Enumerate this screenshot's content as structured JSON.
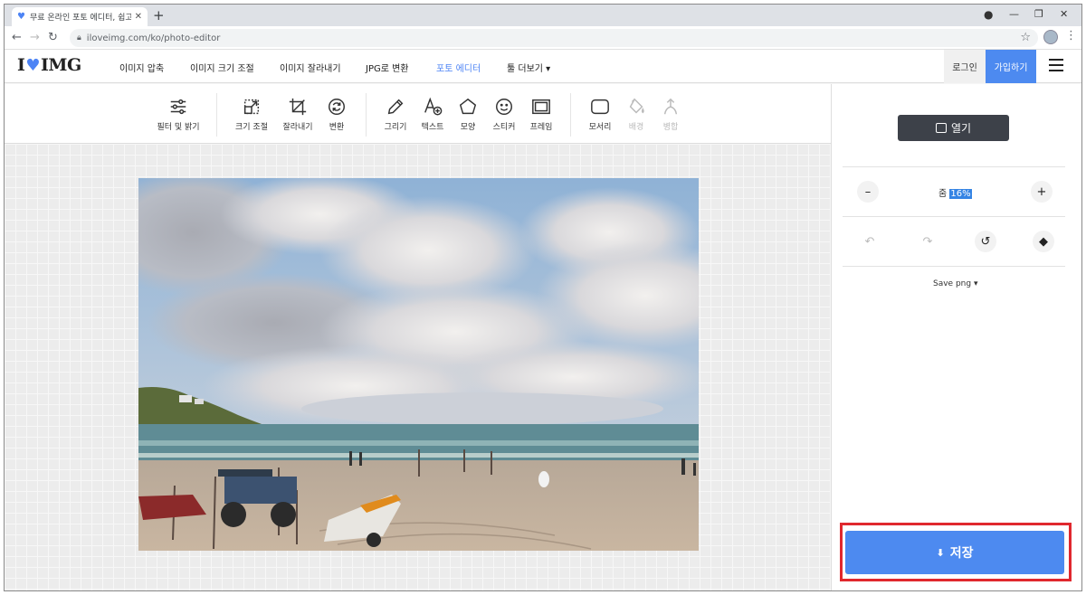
{
  "browser": {
    "tab_title": "무료 온라인 포토 에디터, 쉽고 빠",
    "url": "iloveimg.com/ko/photo-editor"
  },
  "header": {
    "logo_left": "I",
    "logo_right": "IMG",
    "nav": [
      {
        "label": "이미지 압축"
      },
      {
        "label": "이미지 크기 조절"
      },
      {
        "label": "이미지 잘라내기"
      },
      {
        "label": "JPG로 변환"
      },
      {
        "label": "포토 에디터"
      },
      {
        "label": "툴 더보기 ▾"
      }
    ],
    "login_label": "로그인",
    "signup_label": "가입하기"
  },
  "toolbar": {
    "tools": [
      {
        "label": "필터 및 밝기",
        "icon": "sliders-icon"
      },
      {
        "label": "크기 조절",
        "icon": "resize-icon"
      },
      {
        "label": "잘라내기",
        "icon": "crop-icon"
      },
      {
        "label": "변환",
        "icon": "rotate-icon"
      },
      {
        "label": "그리기",
        "icon": "pencil-icon"
      },
      {
        "label": "텍스트",
        "icon": "text-add-icon"
      },
      {
        "label": "모양",
        "icon": "pentagon-icon"
      },
      {
        "label": "스티커",
        "icon": "smiley-icon"
      },
      {
        "label": "프레임",
        "icon": "frame-icon"
      },
      {
        "label": "모서리",
        "icon": "rounded-corner-icon"
      },
      {
        "label": "배경",
        "icon": "paint-bucket-icon"
      },
      {
        "label": "병합",
        "icon": "merge-icon"
      }
    ]
  },
  "panel": {
    "open_label": "열기",
    "zoom_label": "줌",
    "zoom_value": "16%",
    "save_format": "Save png ▾",
    "save_label": "저장"
  },
  "colors": {
    "brand_blue": "#4d8af0",
    "dark_button": "#3d4149",
    "highlight_red": "#e0282e"
  }
}
